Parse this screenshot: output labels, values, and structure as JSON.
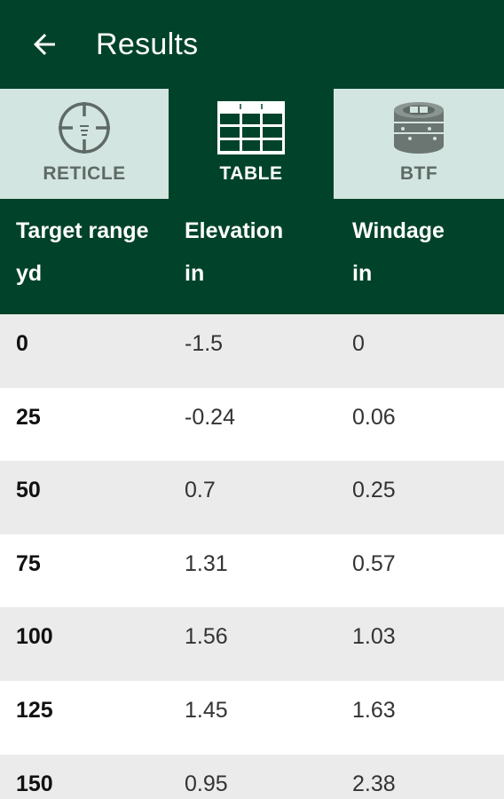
{
  "appbar": {
    "title": "Results",
    "back_icon": "arrow-left-icon"
  },
  "tabs": [
    {
      "label": "RETICLE",
      "icon": "crosshair-icon",
      "active": false
    },
    {
      "label": "TABLE",
      "icon": "grid-table-icon",
      "active": true
    },
    {
      "label": "BTF",
      "icon": "turret-dial-icon",
      "active": false
    }
  ],
  "table": {
    "headers": [
      {
        "line1": "Target range",
        "line2": "yd"
      },
      {
        "line1": "Elevation",
        "line2": "in"
      },
      {
        "line1": "Windage",
        "line2": "in"
      }
    ],
    "rows": [
      {
        "range": "0",
        "elevation": "-1.5",
        "windage": "0"
      },
      {
        "range": "25",
        "elevation": "-0.24",
        "windage": "0.06"
      },
      {
        "range": "50",
        "elevation": "0.7",
        "windage": "0.25"
      },
      {
        "range": "75",
        "elevation": "1.31",
        "windage": "0.57"
      },
      {
        "range": "100",
        "elevation": "1.56",
        "windage": "1.03"
      },
      {
        "range": "125",
        "elevation": "1.45",
        "windage": "1.63"
      },
      {
        "range": "150",
        "elevation": "0.95",
        "windage": "2.38"
      }
    ]
  },
  "colors": {
    "primary": "#00432a",
    "tab_inactive": "#d3e5e0",
    "row_alt": "#ebebeb"
  }
}
